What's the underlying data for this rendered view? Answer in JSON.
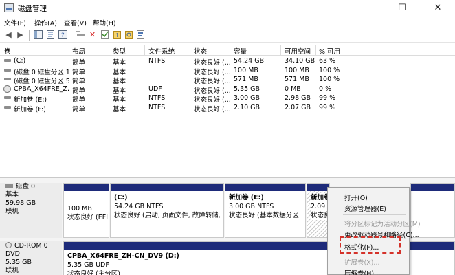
{
  "window": {
    "title": "磁盘管理",
    "minimize": "—",
    "maximize": "☐",
    "close": "✕"
  },
  "menu": [
    "文件(F)",
    "操作(A)",
    "查看(V)",
    "帮助(H)"
  ],
  "toolbar": {
    "back": "◀",
    "forward": "▶",
    "delete": "✕"
  },
  "list": {
    "columns": [
      "卷",
      "布局",
      "类型",
      "文件系统",
      "状态",
      "容量",
      "可用空间",
      "% 可用"
    ],
    "rows": [
      [
        "(C:)",
        "简单",
        "基本",
        "NTFS",
        "状态良好 (...",
        "54.24 GB",
        "34.10 GB",
        "63 %"
      ],
      [
        "(磁盘 0 磁盘分区 1)",
        "简单",
        "基本",
        "",
        "状态良好 (...",
        "100 MB",
        "100 MB",
        "100 %"
      ],
      [
        "(磁盘 0 磁盘分区 5)",
        "简单",
        "基本",
        "",
        "状态良好 (...",
        "571 MB",
        "571 MB",
        "100 %"
      ],
      [
        "CPBA_X64FRE_Z...",
        "简单",
        "基本",
        "UDF",
        "状态良好 (...",
        "5.35 GB",
        "0 MB",
        "0 %"
      ],
      [
        "新加卷 (E:)",
        "简单",
        "基本",
        "NTFS",
        "状态良好 (...",
        "3.00 GB",
        "2.98 GB",
        "99 %"
      ],
      [
        "新加卷 (F:)",
        "简单",
        "基本",
        "NTFS",
        "状态良好 (...",
        "2.10 GB",
        "2.07 GB",
        "99 %"
      ]
    ]
  },
  "disk0": {
    "name": "磁盘 0",
    "type": "基本",
    "size": "59.98 GB",
    "status": "联机",
    "partitions": [
      {
        "title": "",
        "line1": "100 MB",
        "line2": "状态良好 (EFI"
      },
      {
        "title": "(C:)",
        "line1": "54.24 GB NTFS",
        "line2": "状态良好 (启动, 页面文件, 故障转储, 基"
      },
      {
        "title": "新加卷 (E:)",
        "line1": "3.00 GB NTFS",
        "line2": "状态良好 (基本数据分区"
      },
      {
        "title": "新加卷",
        "line1": "2.09 (",
        "line2": "状态良"
      }
    ]
  },
  "cdrom": {
    "name": "CD-ROM 0",
    "type": "DVD",
    "size": "5.35 GB",
    "status": "联机",
    "volume": {
      "title": "CPBA_X64FRE_ZH-CN_DV9 (D:)",
      "line1": "5.35 GB UDF",
      "line2": "状态良好 (主分区)"
    }
  },
  "context_menu": {
    "items": [
      {
        "label": "打开(O)",
        "enabled": true
      },
      {
        "label": "资源管理器(E)",
        "enabled": true
      },
      {
        "label": "将分区标记为活动分区(M)",
        "enabled": false
      },
      {
        "label": "更改驱动器号和路径(C)...",
        "enabled": true
      },
      {
        "label": "格式化(F)...",
        "enabled": true
      },
      {
        "label": "扩展卷(X)...",
        "enabled": false
      },
      {
        "label": "压缩卷(H)...",
        "enabled": true
      }
    ]
  },
  "colors": {
    "partition_bar": "#1e2b7a",
    "highlight": "#d4322a"
  }
}
